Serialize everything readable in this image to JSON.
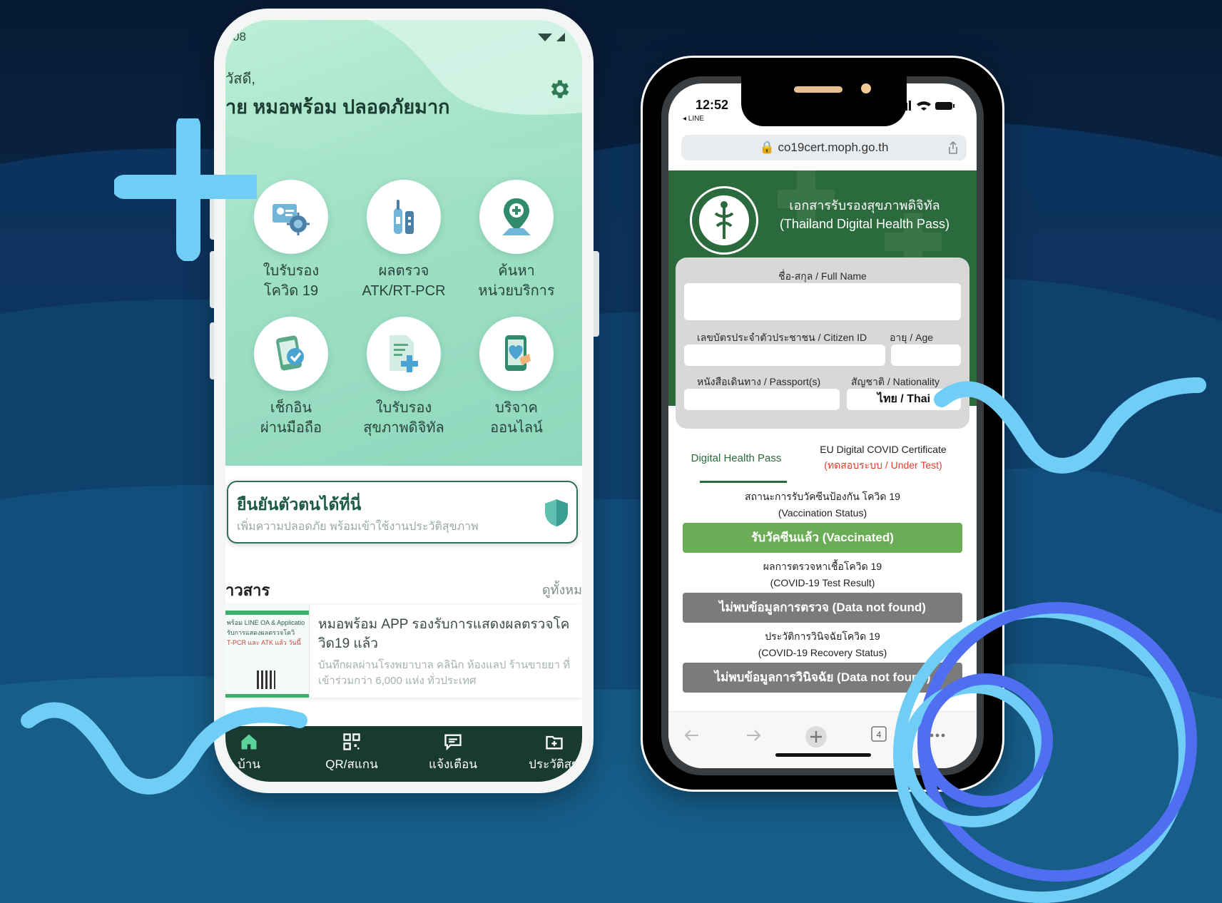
{
  "colors": {
    "background_top": "#0b1f3c",
    "background_bottom": "#165d8a",
    "accent_light_blue": "#6fcdf6",
    "accent_blue_ring": "#4f6ff0",
    "mohpromt_green": "#9fe0c6",
    "moph_green": "#2b6a3c",
    "vaccinated_green": "#6bad57",
    "not_found_grey": "#7b7b7b"
  },
  "left_phone": {
    "status_left": "08",
    "greeting": "วัสดี,",
    "title": "าย หมอพร้อม ปลอดภัยมาก",
    "settings_icon": "gear-icon",
    "tiles": [
      {
        "line1": "ใบรับรอง",
        "line2": "โควิด 19",
        "icon": "certificate-virus-icon"
      },
      {
        "line1": "ผลตรวจ",
        "line2": "ATK/RT-PCR",
        "icon": "test-kit-icon"
      },
      {
        "line1": "ค้นหา",
        "line2": "หน่วยบริการ",
        "icon": "location-pin-icon"
      },
      {
        "line1": "เช็กอิน",
        "line2": "ผ่านมือถือ",
        "icon": "phone-check-icon"
      },
      {
        "line1": "ใบรับรอง",
        "line2": "สุขภาพดิจิทัล",
        "icon": "document-plus-icon"
      },
      {
        "line1": "บริจาค",
        "line2": "ออนไลน์",
        "icon": "phone-heart-icon"
      }
    ],
    "verify": {
      "title": "ยืนยันตัวตนได้ที่นี่",
      "subtitle": "เพิ่มความปลอดภัย พร้อมเข้าใช้งานประวัติสุขภาพ"
    },
    "news": {
      "heading": "าวสาร",
      "see_all": "ดูทั้งหม",
      "card_title": "หมอพร้อม APP รองรับการแสดงผลตรวจโควิด19 แล้ว",
      "card_desc": "บันทึกผลผ่านโรงพยาบาล คลินิก ห้องแลป ร้านขายยา ที่เข้าร่วมกว่า 6,000 แห่ง ทั่วประเทศ",
      "thumb_lines": [
        "พร้อม LINE OA & Applicatio",
        "รับการแสดงผลตรวจโควิ",
        "T-PCR และ ATK แล้ว วันนี้"
      ]
    },
    "bottom_nav": [
      {
        "label": "บ้าน",
        "icon": "home-icon"
      },
      {
        "label": "QR/สแกน",
        "icon": "qr-scan-icon"
      },
      {
        "label": "แจ้งเตือน",
        "icon": "chat-bell-icon"
      },
      {
        "label": "ประวัติสุข",
        "icon": "folder-plus-icon"
      }
    ]
  },
  "right_phone": {
    "time": "12:52",
    "back_app": "◂ LINE",
    "url": "co19cert.moph.go.th",
    "header_title_th": "เอกสารรับรองสุขภาพดิจิทัล",
    "header_title_en": "(Thailand Digital Health Pass)",
    "form": {
      "full_name_label": "ชื่อ-สกุล / Full Name",
      "full_name_value": "",
      "citizen_label": "เลขบัตรประจำตัวประชาชน / Citizen ID",
      "age_label": "อายุ / Age",
      "passport_label": "หนังสือเดินทาง / Passport(s)",
      "nationality_label": "สัญชาติ / Nationality",
      "nationality_value": "ไทย / Thai"
    },
    "tabs": {
      "tab1": "Digital Health Pass",
      "tab2_line1": "EU Digital COVID Certificate",
      "tab2_line2": "(ทดสอบระบบ / Under Test)"
    },
    "vaccination": {
      "label_th": "สถานะการรับวัคซีนป้องกัน โควิด 19",
      "label_en": "(Vaccination Status)",
      "status": "รับวัคซีนแล้ว (Vaccinated)"
    },
    "test_result": {
      "label_th": "ผลการตรวจหาเชื้อโควิด 19",
      "label_en": "(COVID-19 Test Result)",
      "status": "ไม่พบข้อมูลการตรวจ (Data not found)"
    },
    "recovery": {
      "label_th": "ประวัติการวินิจฉัยโควิด 19",
      "label_en": "(COVID-19 Recovery Status)",
      "status": "ไม่พบข้อมูลการวินิจฉัย (Data not found)"
    },
    "safari_tab_count": "4"
  }
}
